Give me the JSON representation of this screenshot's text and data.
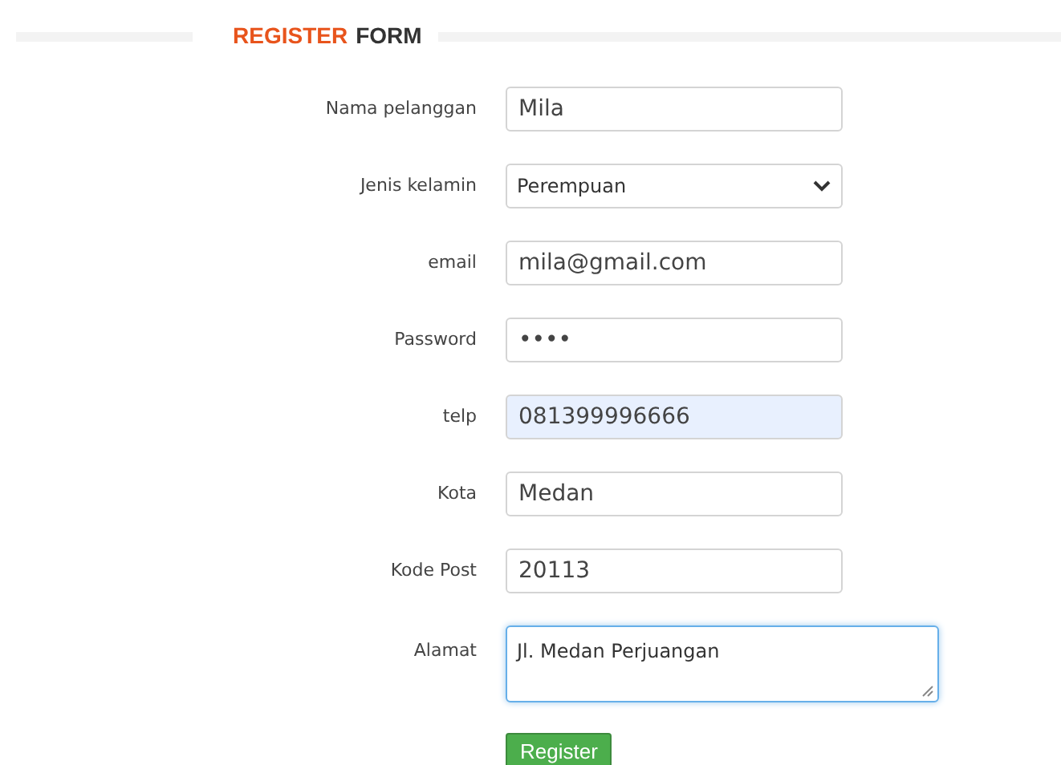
{
  "heading": {
    "accent": "REGISTER",
    "rest": "FORM"
  },
  "fields": [
    {
      "kind": "text",
      "label": "Nama pelanggan",
      "value": "Mila",
      "autofilled": false,
      "focused": false
    },
    {
      "kind": "select",
      "label": "Jenis kelamin",
      "value": "Perempuan",
      "autofilled": false,
      "focused": false
    },
    {
      "kind": "text",
      "label": "email",
      "value": "mila@gmail.com",
      "autofilled": false,
      "focused": false
    },
    {
      "kind": "password",
      "label": "Password",
      "value": "••••",
      "autofilled": false,
      "focused": false
    },
    {
      "kind": "text",
      "label": "telp",
      "value": "081399996666",
      "autofilled": true,
      "focused": false
    },
    {
      "kind": "text",
      "label": "Kota",
      "value": "Medan",
      "autofilled": false,
      "focused": false
    },
    {
      "kind": "text",
      "label": "Kode Post",
      "value": "20113",
      "autofilled": false,
      "focused": false
    },
    {
      "kind": "textarea",
      "label": "Alamat",
      "value": "Jl. Medan Perjuangan",
      "autofilled": false,
      "focused": true
    }
  ],
  "submit": "Register"
}
